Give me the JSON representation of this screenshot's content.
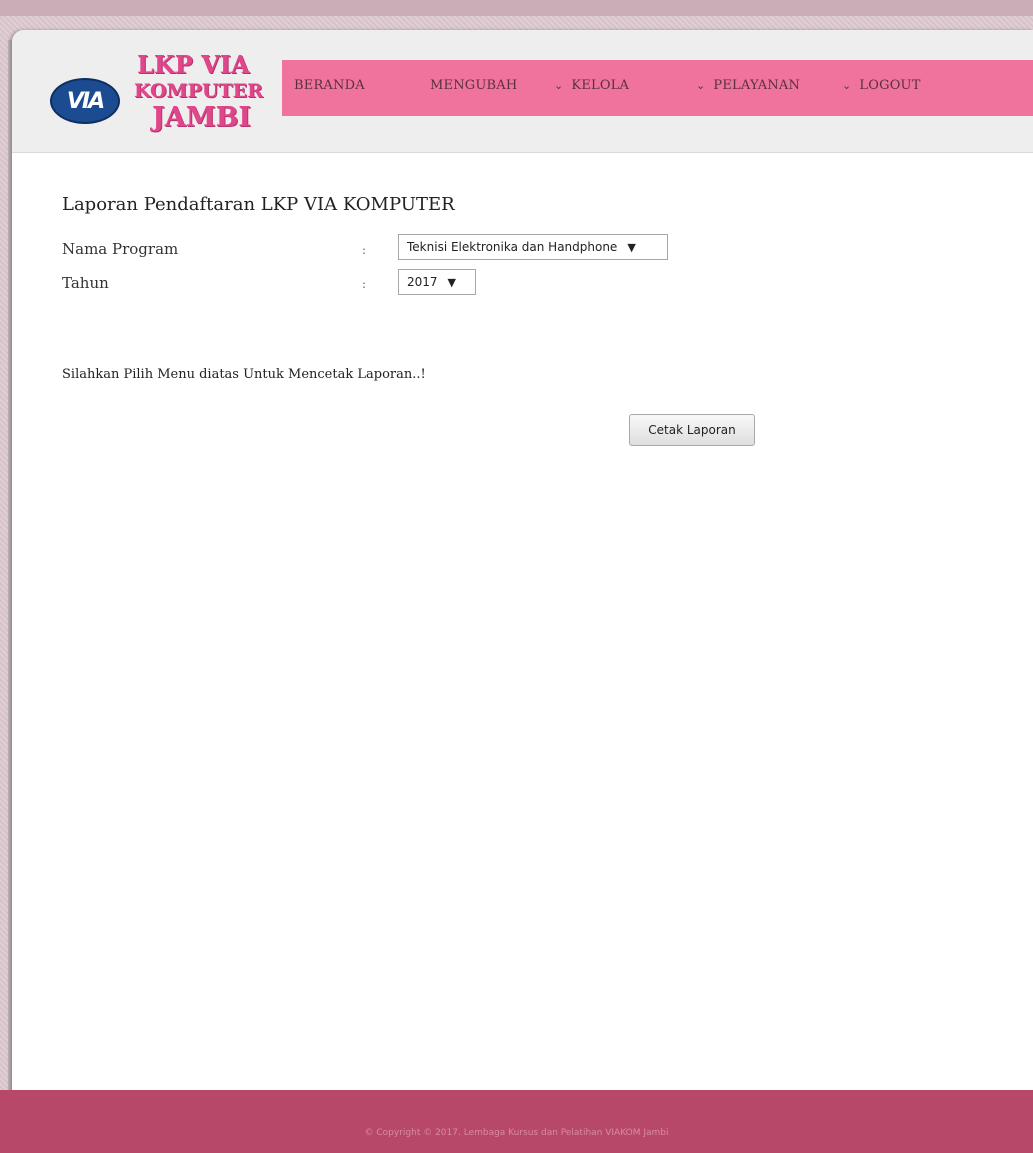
{
  "brand": {
    "logo_mark": "VIA",
    "line1": "LKP VIA",
    "line2": "KOMPUTER",
    "line3": "JAMBI",
    "color": "#e0468a"
  },
  "nav": {
    "items": [
      {
        "label": "BERANDA",
        "has_dropdown": false
      },
      {
        "label": "MENGUBAH",
        "has_dropdown": false
      },
      {
        "label": "KELOLA",
        "has_dropdown": true
      },
      {
        "label": "PELAYANAN",
        "has_dropdown": true
      },
      {
        "label": "LOGOUT",
        "has_dropdown": true
      }
    ],
    "color": "#f0739e"
  },
  "report": {
    "title": "Laporan Pendaftaran LKP VIA KOMPUTER",
    "fields": [
      {
        "label": "Nama Program",
        "colon": ":",
        "value": "Teknisi Elektronika dan Handphone"
      },
      {
        "label": "Tahun",
        "colon": ":",
        "value": "2017"
      }
    ],
    "hint": "Silahkan Pilih Menu diatas Untuk Mencetak Laporan..!",
    "print_button": "Cetak Laporan"
  },
  "footer": {
    "text": "© Copyright © 2017. Lembaga Kursus dan Pelatihan VIAKOM Jambi",
    "color": "#b8486a"
  }
}
